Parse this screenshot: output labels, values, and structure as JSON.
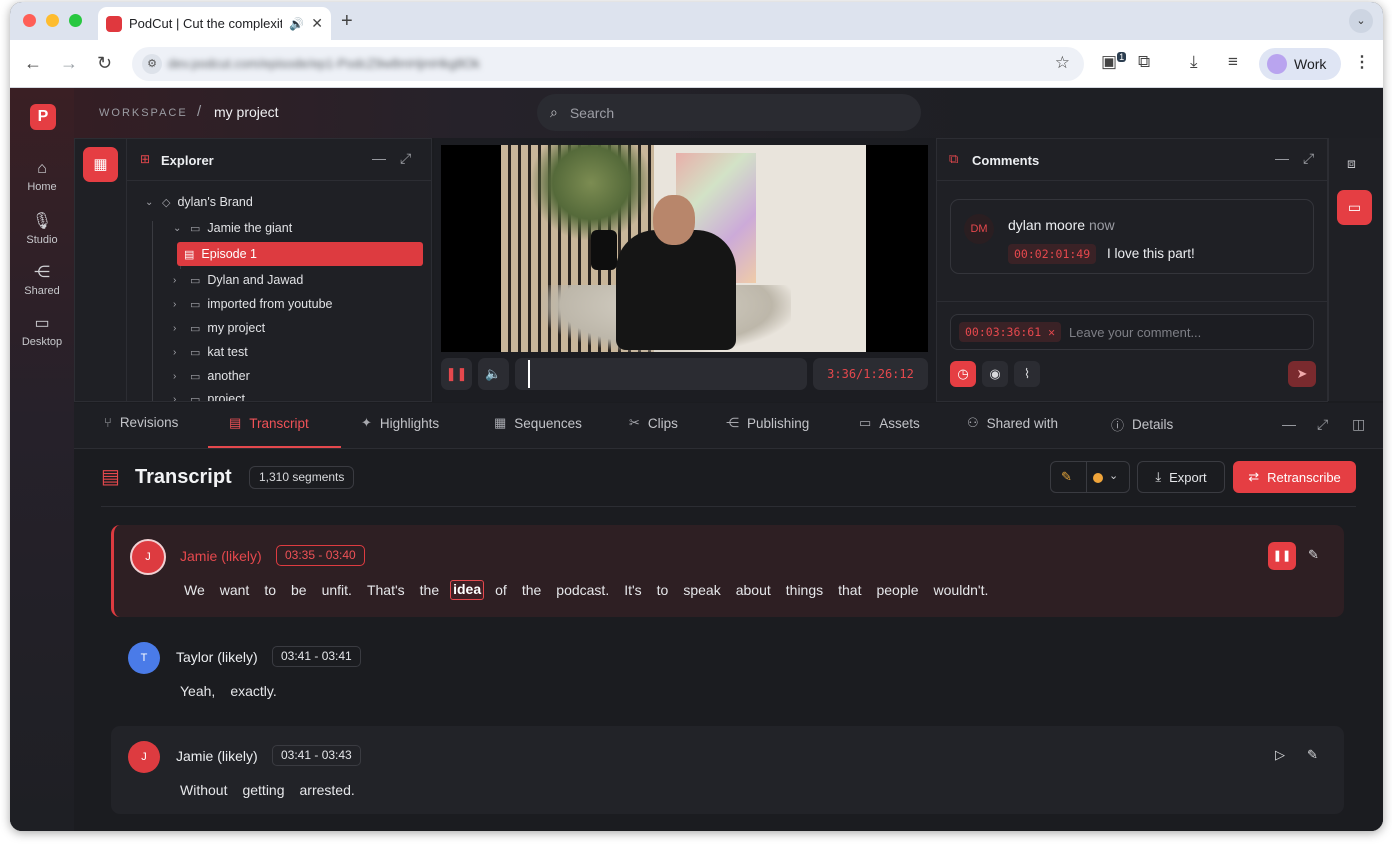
{
  "browser": {
    "tab_title": "PodCut | Cut the complexity",
    "new_tab": "+",
    "url": "dev.podcut.com/episode/ep1-PodcZ9w8mHjmHkg8Ok",
    "profile_label": "Work",
    "extension_badge": "1"
  },
  "app": {
    "logo": "P",
    "nav": [
      {
        "label": "Home",
        "icon": "home-icon"
      },
      {
        "label": "Studio",
        "icon": "mic-icon"
      },
      {
        "label": "Shared",
        "icon": "share-icon"
      },
      {
        "label": "Desktop",
        "icon": "desktop-icon"
      }
    ],
    "breadcrumb": {
      "workspace": "WORKSPACE",
      "separator": "/",
      "project": "my project"
    },
    "search_placeholder": "Search"
  },
  "explorer": {
    "title": "Explorer",
    "tree": [
      {
        "label": "dylan's Brand",
        "depth": 0,
        "expanded": true,
        "icon": "tag-icon"
      },
      {
        "label": "Jamie the giant",
        "depth": 1,
        "expanded": true,
        "icon": "folder-icon"
      },
      {
        "label": "Episode 1",
        "depth": 2,
        "selected": true,
        "icon": "film-icon"
      },
      {
        "label": "Dylan and Jawad",
        "depth": 1,
        "icon": "folder-icon"
      },
      {
        "label": "imported from youtube",
        "depth": 1,
        "icon": "folder-icon"
      },
      {
        "label": "my project",
        "depth": 1,
        "icon": "folder-icon"
      },
      {
        "label": "kat test",
        "depth": 1,
        "icon": "folder-icon"
      },
      {
        "label": "another",
        "depth": 1,
        "icon": "folder-icon"
      },
      {
        "label": "project",
        "depth": 1,
        "icon": "folder-icon"
      }
    ]
  },
  "player": {
    "current_time": "3:36",
    "duration": "1:26:12",
    "timecode": "3:36/1:26:12",
    "progress": 0.0418
  },
  "comments": {
    "title": "Comments",
    "items": [
      {
        "initials": "DM",
        "author": "dylan moore",
        "when": "now",
        "timecode": "00:02:01:49",
        "text": "I love this part!"
      }
    ],
    "input_timecode": "00:03:36:61",
    "input_placeholder": "Leave your comment..."
  },
  "tabs": [
    {
      "label": "Revisions",
      "icon": "branch-icon"
    },
    {
      "label": "Transcript",
      "icon": "document-icon",
      "active": true
    },
    {
      "label": "Highlights",
      "icon": "sparkle-icon"
    },
    {
      "label": "Sequences",
      "icon": "film-icon"
    },
    {
      "label": "Clips",
      "icon": "scissors-icon"
    },
    {
      "label": "Publishing",
      "icon": "share-icon"
    },
    {
      "label": "Assets",
      "icon": "folder-icon"
    },
    {
      "label": "Shared with",
      "icon": "users-icon"
    },
    {
      "label": "Details",
      "icon": "info-icon"
    }
  ],
  "transcript": {
    "title": "Transcript",
    "segment_count": "1,310 segments",
    "export_label": "Export",
    "retranscribe_label": "Retranscribe",
    "colors": {
      "accent": "#e53e43",
      "speaker_j": "#dd3b40",
      "speaker_t": "#4a7be8",
      "edit_dot": "#f0a43a"
    },
    "segments": [
      {
        "avatar": "J",
        "speaker": "Jamie (likely)",
        "time": "03:35 - 03:40",
        "active": true,
        "highlight_word": "idea",
        "words": [
          "We",
          "want",
          "to",
          "be",
          "unfit.",
          "That's",
          "the",
          "idea",
          "of",
          "the",
          "podcast.",
          "It's",
          "to",
          "speak",
          "about",
          "things",
          "that",
          "people",
          "wouldn't."
        ]
      },
      {
        "avatar": "T",
        "speaker": "Taylor (likely)",
        "time": "03:41 - 03:41",
        "words": [
          "Yeah,",
          "exactly."
        ]
      },
      {
        "avatar": "J",
        "speaker": "Jamie (likely)",
        "time": "03:41 - 03:43",
        "words": [
          "Without",
          "getting",
          "arrested."
        ]
      }
    ]
  }
}
